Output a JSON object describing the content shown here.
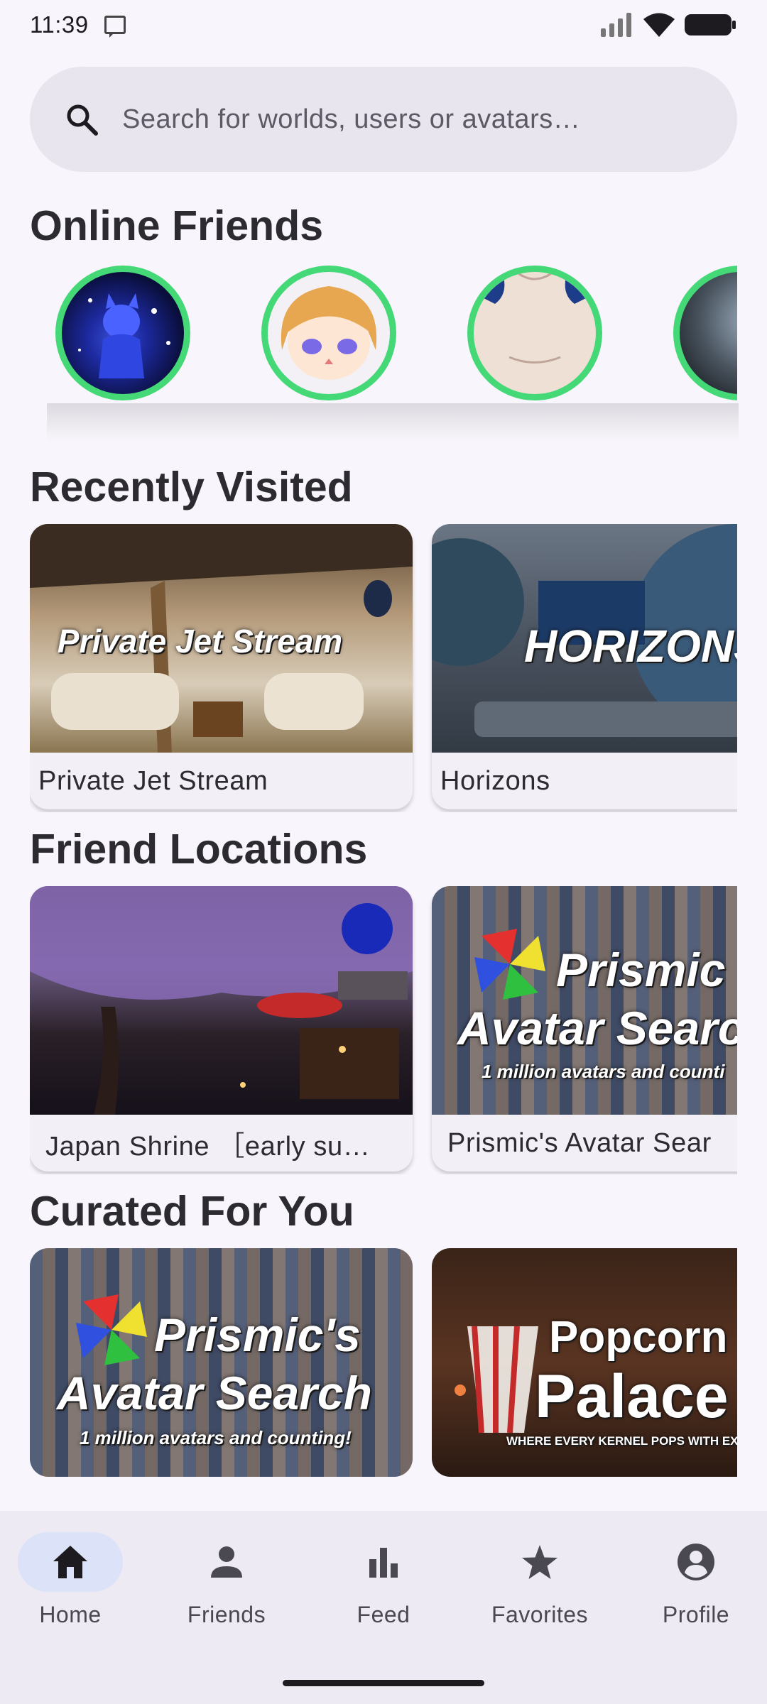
{
  "status": {
    "time": "11:39",
    "icons": [
      "nfc-icon",
      "signal-icon",
      "wifi-icon",
      "battery-icon"
    ]
  },
  "search": {
    "placeholder": "Search for worlds, users or avatars…",
    "icon": "search-icon"
  },
  "sections": {
    "online_friends": "Online Friends",
    "recently_visited": "Recently Visited",
    "friend_locations": "Friend Locations",
    "curated": "Curated For You"
  },
  "online_friends": [
    {
      "avatar": "blue-cat-avatar"
    },
    {
      "avatar": "blonde-anime-avatar"
    },
    {
      "avatar": "white-creature-avatar"
    },
    {
      "avatar": "dark-sphere-avatar"
    }
  ],
  "recently_visited": [
    {
      "title": "Private Jet Stream",
      "thumb_text": "Private Jet Stream"
    },
    {
      "title": "Horizons",
      "thumb_text": "HORIZONS"
    }
  ],
  "friend_locations": [
    {
      "title": "Japan Shrine ［early su…"
    },
    {
      "title": "Prismic's Avatar Sear",
      "thumb_line1": "Prismic",
      "thumb_line2": "Avatar Searc",
      "thumb_line3": "1 million avatars and counti"
    }
  ],
  "curated": [
    {
      "thumb_line1": "Prismic's",
      "thumb_line2": "Avatar Search",
      "thumb_line3": "1 million avatars and counting!"
    },
    {
      "thumb_line1": "Popcorn",
      "thumb_line2": "Palace",
      "thumb_line3": "WHERE EVERY KERNEL POPS WITH EXCITEMENT"
    }
  ],
  "nav": {
    "items": [
      {
        "label": "Home",
        "icon": "home-icon",
        "active": true
      },
      {
        "label": "Friends",
        "icon": "person-icon",
        "active": false
      },
      {
        "label": "Feed",
        "icon": "bar-chart-icon",
        "active": false
      },
      {
        "label": "Favorites",
        "icon": "star-icon",
        "active": false
      },
      {
        "label": "Profile",
        "icon": "account-circle-icon",
        "active": false
      }
    ]
  },
  "colors": {
    "background": "#f8f5fc",
    "search_bg": "#e8e5ef",
    "online_ring": "#44d877",
    "nav_bg": "#edeaf3",
    "nav_active": "#dce3f8"
  }
}
